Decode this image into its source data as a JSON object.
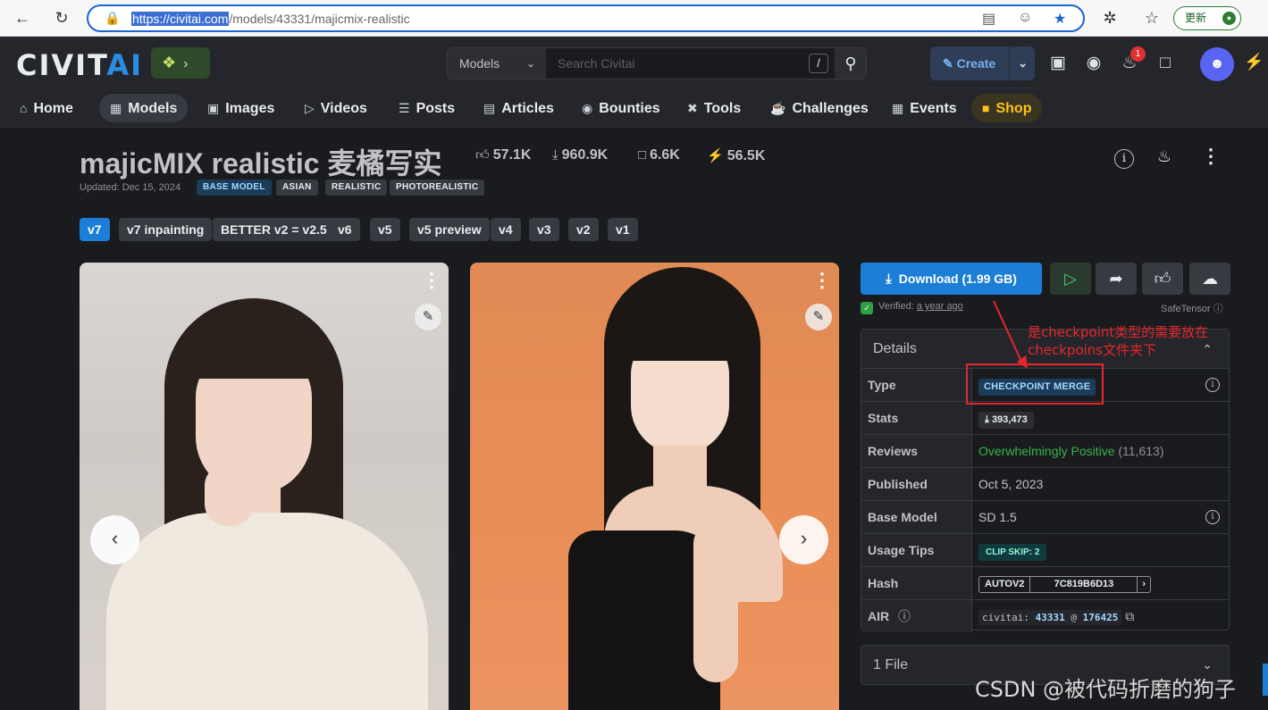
{
  "browser": {
    "url_host": "https://civitai.com",
    "url_path": "/models/43331/majicmix-realistic",
    "update_label": "更新"
  },
  "header": {
    "logo": "CIVITAI",
    "search_scope": "Models",
    "search_placeholder": "Search Civitai",
    "search_shortcut": "/",
    "create_label": "Create",
    "notification_count": "1"
  },
  "nav": {
    "items": [
      {
        "label": "Home",
        "icon": "home-icon"
      },
      {
        "label": "Models",
        "icon": "models-icon"
      },
      {
        "label": "Images",
        "icon": "images-icon"
      },
      {
        "label": "Videos",
        "icon": "videos-icon"
      },
      {
        "label": "Posts",
        "icon": "posts-icon"
      },
      {
        "label": "Articles",
        "icon": "articles-icon"
      },
      {
        "label": "Bounties",
        "icon": "bounties-icon"
      },
      {
        "label": "Tools",
        "icon": "tools-icon"
      },
      {
        "label": "Challenges",
        "icon": "trophy-icon"
      },
      {
        "label": "Events",
        "icon": "calendar-icon"
      },
      {
        "label": "Shop",
        "icon": "shop-icon"
      }
    ]
  },
  "model": {
    "title": "majicMIX realistic 麦橘写实",
    "likes": "57.1K",
    "downloads": "960.9K",
    "bookmarks": "6.6K",
    "buzz": "56.5K",
    "updated": "Updated: Dec 15, 2024",
    "tags": [
      "BASE MODEL",
      "ASIAN",
      "REALISTIC",
      "PHOTOREALISTIC"
    ],
    "versions": [
      "v7",
      "v7 inpainting",
      "BETTER v2 = v2.5",
      "v6",
      "v5",
      "v5 preview",
      "v4",
      "v3",
      "v2",
      "v1"
    ]
  },
  "sidebar": {
    "download_label": "Download (1.99 GB)",
    "verified_prefix": "Verified:",
    "verified_time": "a year ago",
    "safetensor": "SafeTensor",
    "details_title": "Details",
    "rows": {
      "type_label": "Type",
      "type_value": "CHECKPOINT MERGE",
      "stats_label": "Stats",
      "stats_value": "393,473",
      "reviews_label": "Reviews",
      "reviews_value": "Overwhelmingly Positive",
      "reviews_count": "(11,613)",
      "published_label": "Published",
      "published_value": "Oct 5, 2023",
      "base_label": "Base Model",
      "base_value": "SD 1.5",
      "tips_label": "Usage Tips",
      "tips_value": "CLIP SKIP: 2",
      "hash_label": "Hash",
      "hash_type": "AUTOV2",
      "hash_value": "7C819B6D13",
      "air_label": "AIR",
      "air_prefix": "civitai:",
      "air_model": "43331",
      "air_at": "@",
      "air_version": "176425"
    },
    "files_label": "1 File"
  },
  "annotation": {
    "line1": "是checkpoint类型的需要放在",
    "line2": "checkpoins文件夹下"
  },
  "watermark": "CSDN @被代码折磨的狗子",
  "colors": {
    "accent": "#1c7ed6",
    "background": "#1a1b1e",
    "annotation": "#e5272c",
    "positive": "#37b24d"
  }
}
